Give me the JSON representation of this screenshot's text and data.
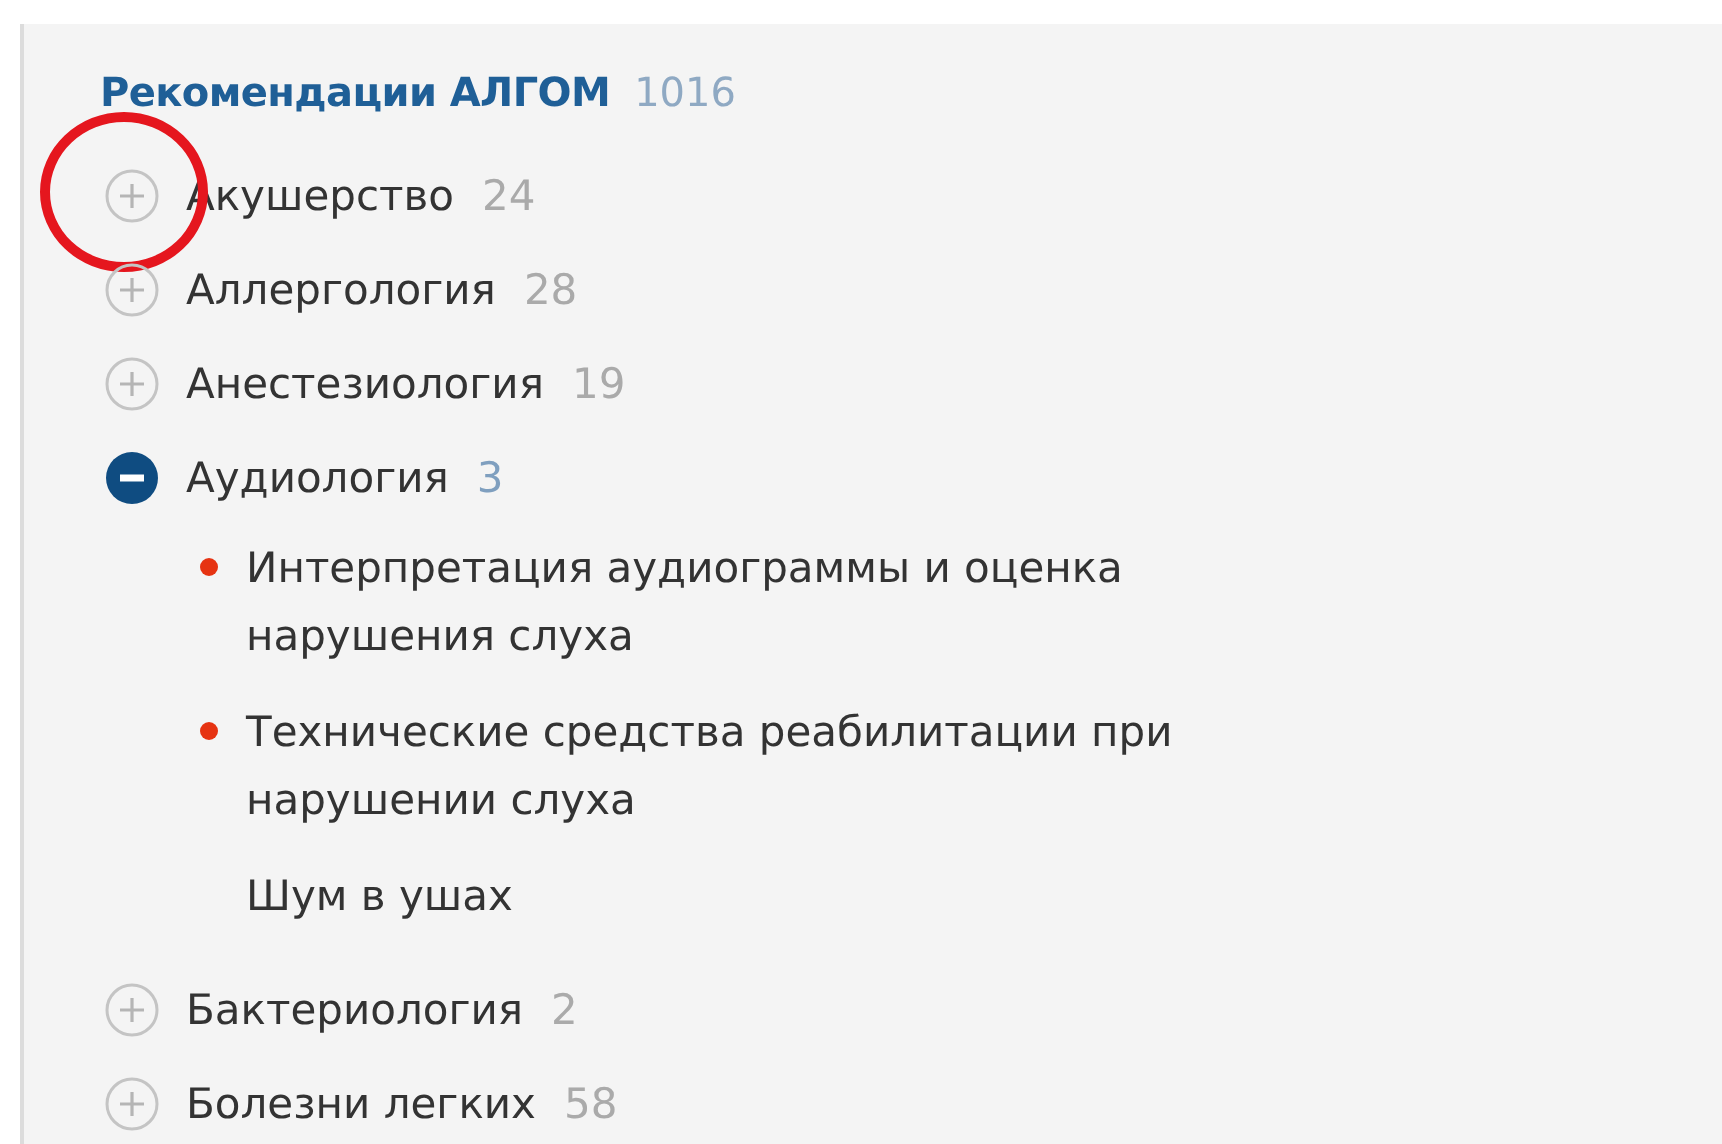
{
  "title": {
    "label": "Рекомендации АЛГОМ",
    "count": "1016"
  },
  "categories": [
    {
      "label": "Акушерство",
      "count": "24",
      "expanded": false,
      "circled": true
    },
    {
      "label": "Аллергология",
      "count": "28",
      "expanded": false,
      "circled": false
    },
    {
      "label": "Анестезиология",
      "count": "19",
      "expanded": false,
      "circled": false
    },
    {
      "label": "Аудиология",
      "count": "3",
      "expanded": true,
      "circled": false,
      "children": [
        {
          "label": "Интерпретация аудиограммы и оценка нарушения слуха",
          "marked": true
        },
        {
          "label": "Технические средства реабилитации при нарушении слуха",
          "marked": true
        },
        {
          "label": "Шум в ушах",
          "marked": false
        }
      ]
    },
    {
      "label": "Бактериология",
      "count": "2",
      "expanded": false,
      "circled": false
    },
    {
      "label": "Болезни легких",
      "count": "58",
      "expanded": false,
      "circled": false
    }
  ]
}
